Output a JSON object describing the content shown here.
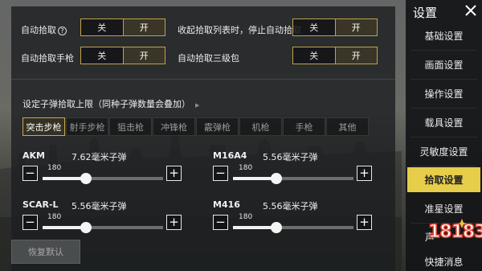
{
  "settings_top": {
    "auto_pickup_label": "自动拾取",
    "auto_pickup_help_glyph": "?",
    "auto_pickup_pistol_label": "自动拾取手枪",
    "collapse_stop_label": "收起拾取列表时，停止自动拾取",
    "auto_pickup_lvl3_bag_label": "自动拾取三级包",
    "off_label": "关",
    "on_label": "开",
    "active": "on"
  },
  "ammo_section": {
    "title": "设定子弹拾取上限（同种子弹数量会叠加）",
    "tabs": [
      "突击步枪",
      "射手步枪",
      "狙击枪",
      "冲锋枪",
      "霰弹枪",
      "机枪",
      "手枪",
      "其他"
    ],
    "active_tab": 0,
    "slider_max": 300,
    "weapons": [
      {
        "name": "AKM",
        "ammo": "7.62毫米子弹",
        "value": "180",
        "fraction": 0.36
      },
      {
        "name": "M16A4",
        "ammo": "5.56毫米子弹",
        "value": "180",
        "fraction": 0.36
      },
      {
        "name": "SCAR-L",
        "ammo": "5.56毫米子弹",
        "value": "180",
        "fraction": 0.36
      },
      {
        "name": "M416",
        "ammo": "5.56毫米子弹",
        "value": "180",
        "fraction": 0.36
      }
    ],
    "minus_glyph": "−",
    "plus_glyph": "+"
  },
  "restore_default_label": "恢复默认",
  "sidebar": {
    "title": "设置",
    "items": [
      "基础设置",
      "画面设置",
      "操作设置",
      "载具设置",
      "灵敏度设置",
      "拾取设置",
      "准星设置",
      "声音设置",
      "快捷消息"
    ],
    "visible_item_text": [
      "基础设置",
      "画面设置",
      "操作设置",
      "载具设置",
      "灵敏度设置",
      "拾取设置",
      "准星设置",
      "声",
      "快捷消息"
    ],
    "active_index": 5
  },
  "watermark": {
    "text": "18183"
  },
  "colors": {
    "accent_gold": "#bfa24a",
    "active_nav": "#e6cd4a",
    "watermark_red": "#e0412f"
  },
  "icons": {
    "close": "close-icon",
    "help": "help-icon",
    "minus": "minus-icon",
    "plus": "plus-icon"
  }
}
